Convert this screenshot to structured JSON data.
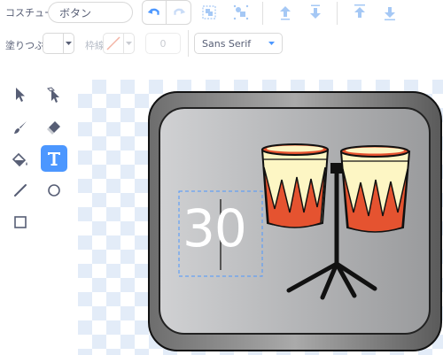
{
  "costume": {
    "label": "コスチューム",
    "name_value": "ボタン"
  },
  "toolbar": {
    "undo_icon": "undo-icon",
    "redo_icon": "redo-icon",
    "group_icon": "group-icon",
    "ungroup_icon": "ungroup-icon",
    "forward_icon": "forward-icon",
    "backward_icon": "backward-icon",
    "front_icon": "front-icon",
    "back_icon": "back-icon"
  },
  "style_bar": {
    "fill_label": "塗りつぶし",
    "outline_label": "枠線",
    "outline_width_value": "0",
    "font_value": "Sans Serif"
  },
  "tools": [
    "reshape",
    "select",
    "brush",
    "eraser",
    "fill",
    "text",
    "line",
    "circle",
    "rectangle"
  ],
  "canvas": {
    "text_value": "30"
  },
  "colors": {
    "accent": "#4c97ff",
    "text": "#575e75",
    "drum_orange": "#e55330",
    "drum_cream": "#fdf6c4"
  }
}
